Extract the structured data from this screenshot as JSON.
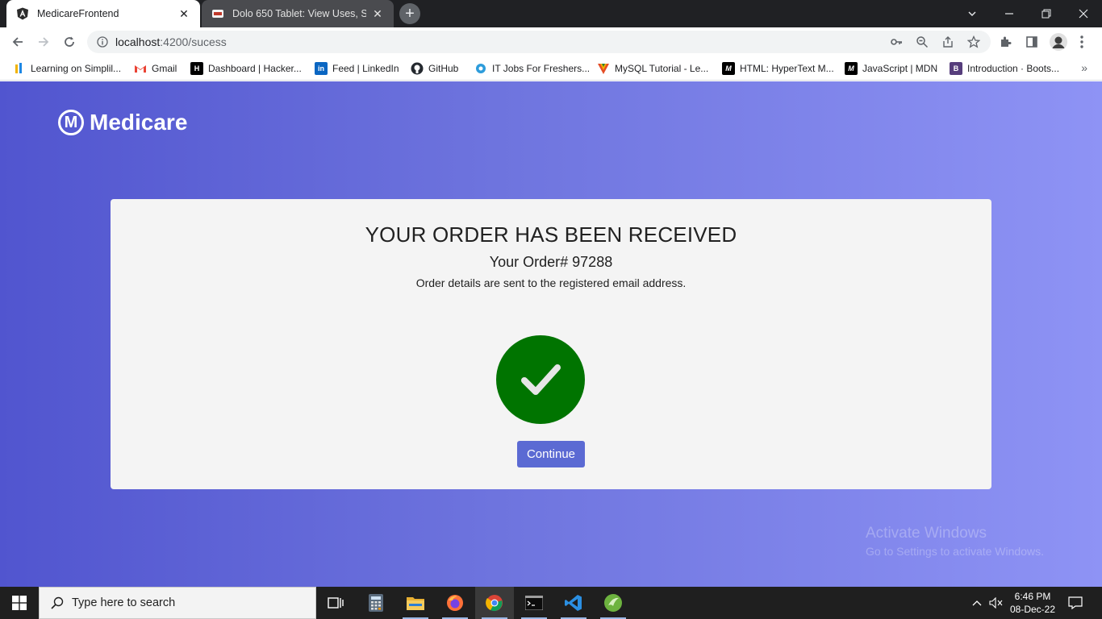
{
  "browser": {
    "tabs": [
      {
        "title": "MedicareFrontend",
        "close": "✕"
      },
      {
        "title": "Dolo 650 Tablet: View Uses, Side",
        "close": "✕"
      }
    ],
    "new_tab": "+",
    "url_host": "localhost",
    "url_path": ":4200/sucess",
    "bookmarks": [
      {
        "label": "Learning on Simplil...",
        "icon": "simplilearn-icon",
        "color": "#f2b400"
      },
      {
        "label": "Gmail",
        "icon": "gmail-icon",
        "color": "#ea4335"
      },
      {
        "label": "Dashboard | Hacker...",
        "icon": "hackerrank-icon",
        "color": "#000000"
      },
      {
        "label": "Feed | LinkedIn",
        "icon": "linkedin-icon",
        "color": "#0a66c2"
      },
      {
        "label": "GitHub",
        "icon": "github-icon",
        "color": "#24292f"
      },
      {
        "label": "IT Jobs For Freshers...",
        "icon": "jobs-icon",
        "color": "#2d9cdb"
      },
      {
        "label": "MySQL Tutorial - Le...",
        "icon": "mysql-icon",
        "color": "#e44d26"
      },
      {
        "label": "HTML: HyperText M...",
        "icon": "mdn-icon",
        "color": "#000000"
      },
      {
        "label": "JavaScript | MDN",
        "icon": "mdn-icon",
        "color": "#000000"
      },
      {
        "label": "Introduction · Boots...",
        "icon": "bootstrap-icon",
        "color": "#563d7c"
      }
    ],
    "bookmarks_more": "»"
  },
  "app": {
    "brand": "Medicare",
    "brand_logo_letter": "M",
    "heading": "YOUR ORDER HAS BEEN RECEIVED",
    "order_label": "Your Order# 97288",
    "note": "Order details are sent to the registered email address.",
    "continue_label": "Continue",
    "check_color": "#007400",
    "accent": "#5b6ad3"
  },
  "watermark": {
    "line1": "Activate Windows",
    "line2": "Go to Settings to activate Windows."
  },
  "taskbar": {
    "search_placeholder": "Type here to search",
    "time": "6:46 PM",
    "date": "08-Dec-22"
  }
}
